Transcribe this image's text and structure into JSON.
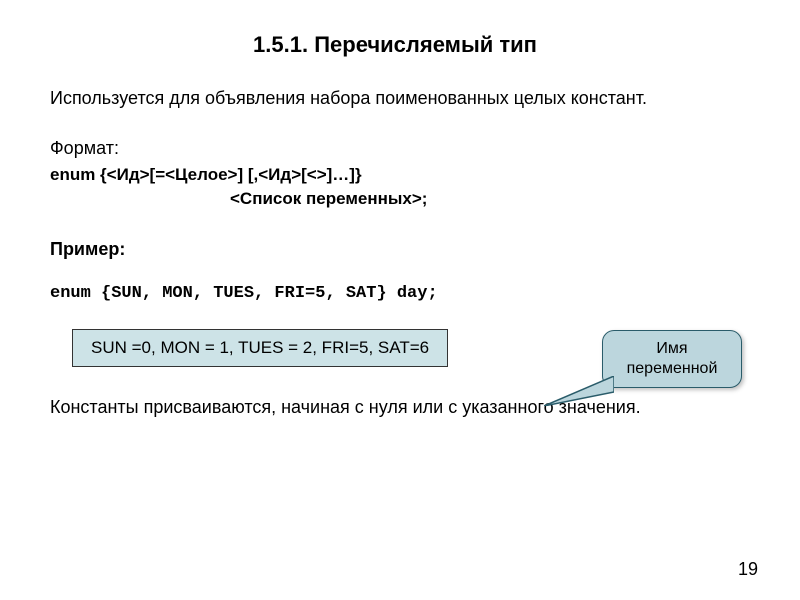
{
  "title": "1.5.1. Перечисляемый тип",
  "intro": "Используется для объявления набора поименованных целых констант.",
  "format_label": "Формат:",
  "format_line1": "enum {<Ид>[=<Целое>] [,<Ид>[<>]…]}",
  "format_line2": "<Список переменных>;",
  "example_label": "Пример:",
  "example_code": "enum {SUN, MON, TUES, FRI=5, SAT} day;",
  "callout": {
    "line1": "Имя",
    "line2": "переменной"
  },
  "values_box": "SUN =0, MON = 1, TUES = 2, FRI=5, SAT=6",
  "conclusion": "Константы присваиваются, начиная с нуля или с указанного значения.",
  "page_number": "19"
}
